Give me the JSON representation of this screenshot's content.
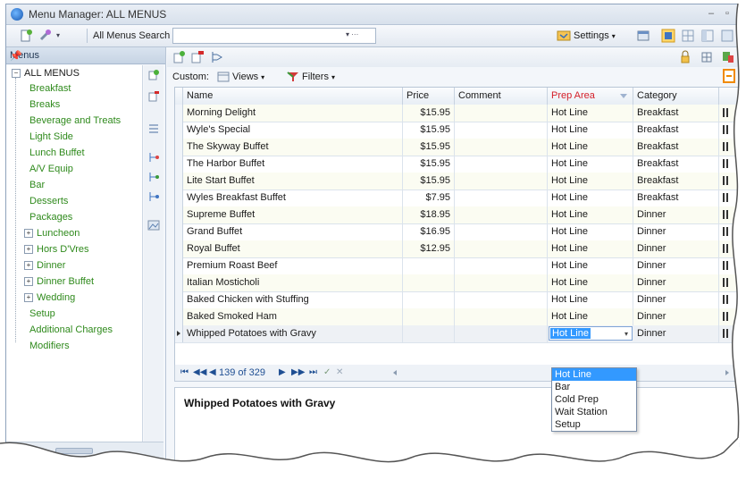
{
  "window": {
    "title": "Menu Manager:  ALL MENUS"
  },
  "toolbar": {
    "search_label": "All Menus Search",
    "search_value": "",
    "settings_label": "Settings"
  },
  "menus_panel": {
    "header": "Menus",
    "root": "ALL MENUS",
    "items": [
      {
        "label": "Breakfast",
        "type": "leaf"
      },
      {
        "label": "Breaks",
        "type": "leaf"
      },
      {
        "label": "Beverage and Treats",
        "type": "leaf"
      },
      {
        "label": "Light Side",
        "type": "leaf"
      },
      {
        "label": "Lunch Buffet",
        "type": "leaf"
      },
      {
        "label": "A/V Equip",
        "type": "leaf"
      },
      {
        "label": "Bar",
        "type": "leaf"
      },
      {
        "label": "Desserts",
        "type": "leaf"
      },
      {
        "label": "Packages",
        "type": "leaf"
      },
      {
        "label": "Luncheon",
        "type": "branch"
      },
      {
        "label": "Hors D'Vres",
        "type": "branch"
      },
      {
        "label": "Dinner",
        "type": "branch"
      },
      {
        "label": "Dinner Buffet",
        "type": "branch"
      },
      {
        "label": "Wedding",
        "type": "branch"
      },
      {
        "label": "Setup",
        "type": "leaf"
      },
      {
        "label": "Additional Charges",
        "type": "leaf"
      },
      {
        "label": "Modifiers",
        "type": "leaf"
      }
    ]
  },
  "custom_bar": {
    "label": "Custom:",
    "views": "Views",
    "filters": "Filters"
  },
  "grid": {
    "columns": [
      "Name",
      "Price",
      "Comment",
      "Prep Area",
      "Category"
    ],
    "rows": [
      {
        "name": "Morning Delight",
        "price": "$15.95",
        "comment": "",
        "prep": "Hot Line",
        "category": "Breakfast"
      },
      {
        "name": "Wyle's Special",
        "price": "$15.95",
        "comment": "",
        "prep": "Hot Line",
        "category": "Breakfast"
      },
      {
        "name": "The Skyway Buffet",
        "price": "$15.95",
        "comment": "",
        "prep": "Hot Line",
        "category": "Breakfast"
      },
      {
        "name": "The Harbor Buffet",
        "price": "$15.95",
        "comment": "",
        "prep": "Hot Line",
        "category": "Breakfast"
      },
      {
        "name": "Lite Start Buffet",
        "price": "$15.95",
        "comment": "",
        "prep": "Hot Line",
        "category": "Breakfast"
      },
      {
        "name": "Wyles Breakfast Buffet",
        "price": "$7.95",
        "comment": "",
        "prep": "Hot Line",
        "category": "Breakfast"
      },
      {
        "name": "Supreme Buffet",
        "price": "$18.95",
        "comment": "",
        "prep": "Hot Line",
        "category": "Dinner"
      },
      {
        "name": "Grand Buffet",
        "price": "$16.95",
        "comment": "",
        "prep": "Hot Line",
        "category": "Dinner"
      },
      {
        "name": "Royal Buffet",
        "price": "$12.95",
        "comment": "",
        "prep": "Hot Line",
        "category": "Dinner"
      },
      {
        "name": "Premium Roast Beef",
        "price": "",
        "comment": "",
        "prep": "Hot Line",
        "category": "Dinner"
      },
      {
        "name": "Italian Mosticholi",
        "price": "",
        "comment": "",
        "prep": "Hot Line",
        "category": "Dinner"
      },
      {
        "name": "Baked Chicken with Stuffing",
        "price": "",
        "comment": "",
        "prep": "Hot Line",
        "category": "Dinner"
      },
      {
        "name": "Baked Smoked Ham",
        "price": "",
        "comment": "",
        "prep": "Hot Line",
        "category": "Dinner"
      },
      {
        "name": "Whipped Potatoes with Gravy",
        "price": "",
        "comment": "",
        "prep": "Hot Line",
        "category": "Dinner"
      }
    ]
  },
  "prep_dropdown": {
    "options": [
      "Hot Line",
      "Bar",
      "Cold Prep",
      "Wait Station",
      "Setup"
    ],
    "selected": "Hot Line"
  },
  "navigator": {
    "position": "139 of 329"
  },
  "detail": {
    "title": "Whipped Potatoes with Gravy"
  }
}
